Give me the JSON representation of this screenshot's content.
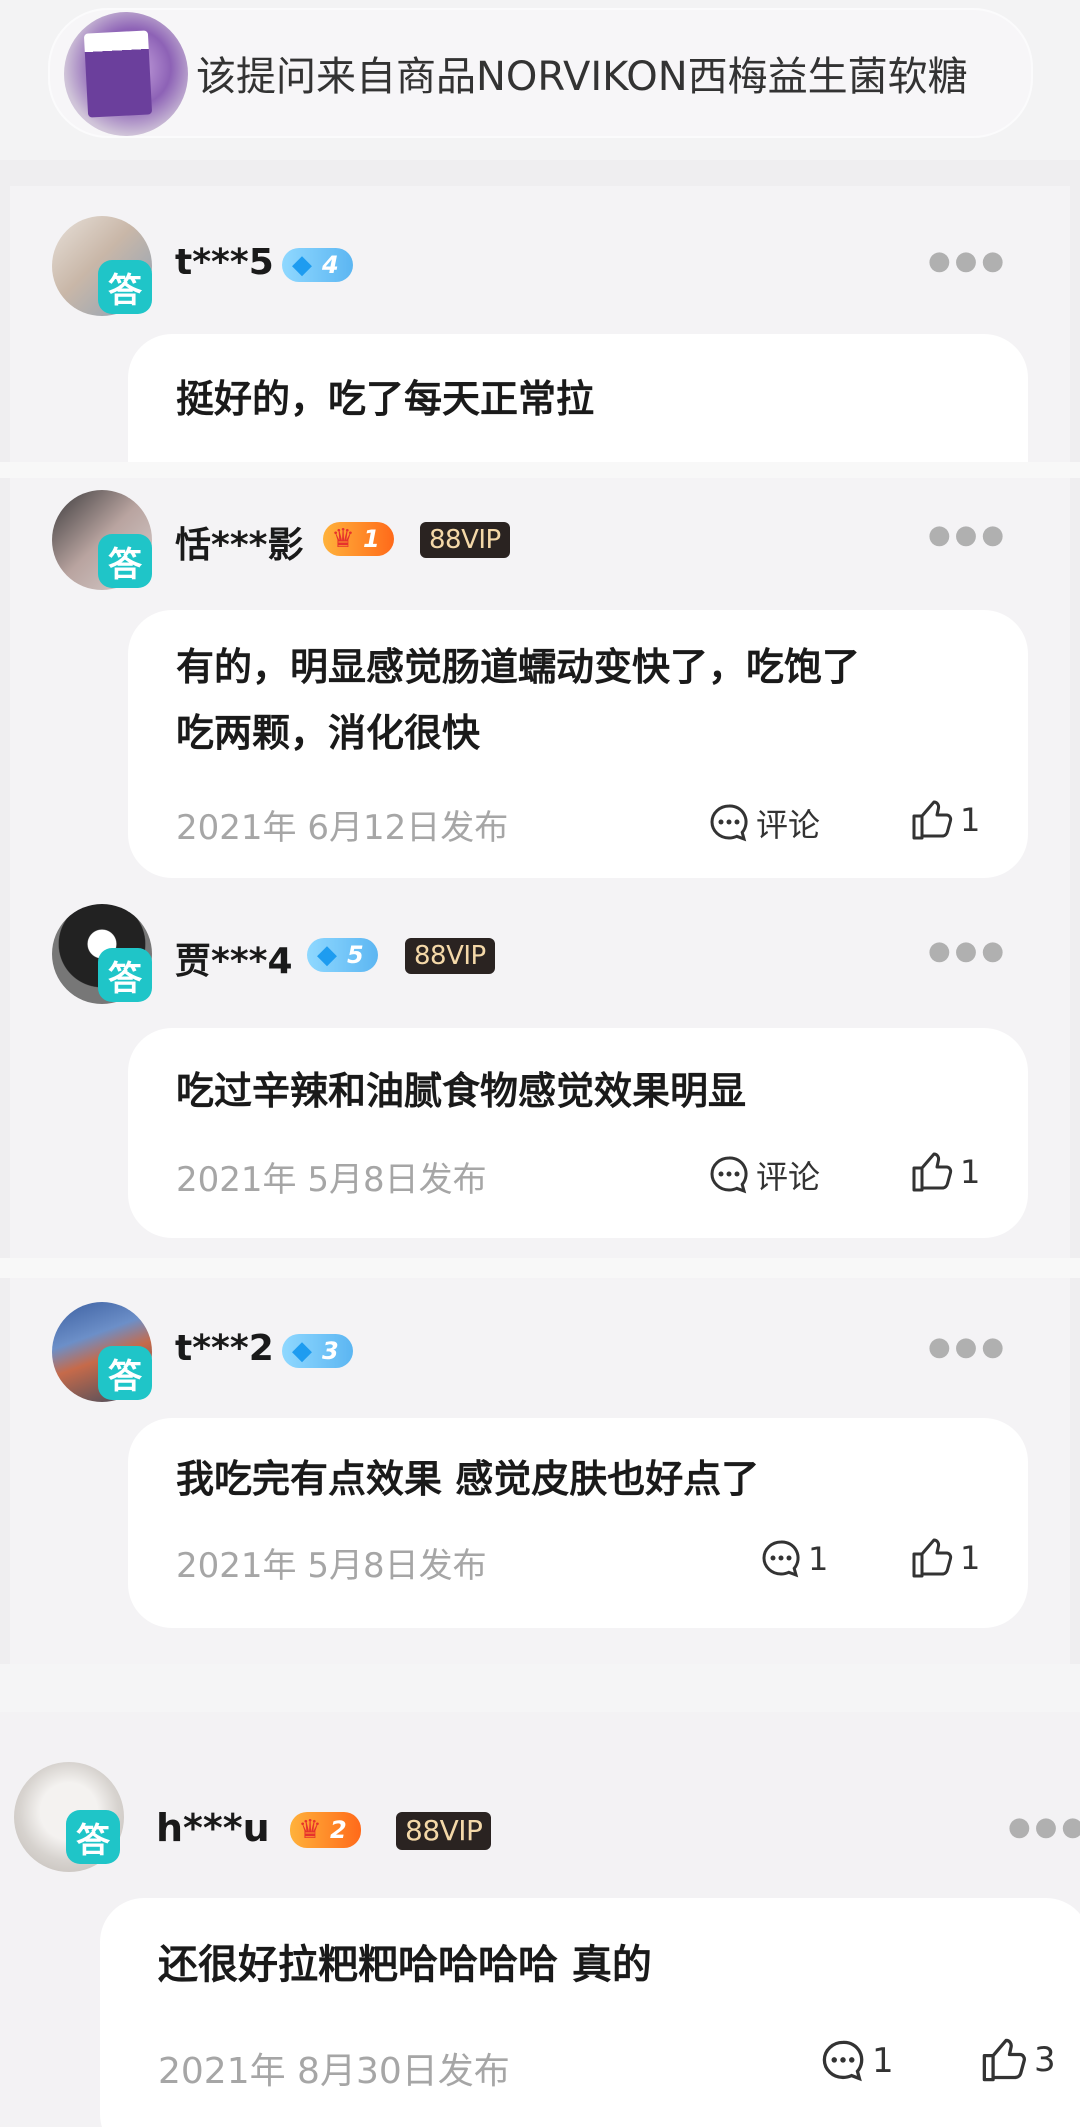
{
  "product": {
    "text": "该提问来自商品NORVIKON西梅益生菌软糖",
    "thumb": "product-thumbnail"
  },
  "answer_badge": "答",
  "icons": {
    "more": "more-dots-icon",
    "comment": "comment-bubble-icon",
    "like": "thumbs-up-icon",
    "diamond": "diamond-icon",
    "crown": "crown-icon"
  },
  "colors": {
    "answer_badge": "#1fc5c8",
    "vip_bg": "#2a2321",
    "vip_text": "#f4d8a8",
    "date": "#a6a6a6"
  },
  "answers": [
    {
      "username": "t***5",
      "level": {
        "type": "diamond",
        "value": "4"
      },
      "vip": "",
      "text": "挺好的，吃了每天正常拉"
    },
    {
      "username": "恬***影",
      "level": {
        "type": "crown",
        "value": "1"
      },
      "vip": "88VIP",
      "text_line1": "有的，明显感觉肠道蠕动变快了，吃饱了",
      "text_line2": "吃两颗，消化很快",
      "date": "2021年 6月12日发布",
      "comment_label": "评论",
      "likes": "1"
    },
    {
      "username": "贾***4",
      "level": {
        "type": "diamond",
        "value": "5"
      },
      "vip": "88VIP",
      "text": "吃过辛辣和油腻食物感觉效果明显",
      "date": "2021年 5月8日发布",
      "comment_label": "评论",
      "likes": "1"
    },
    {
      "username": "t***2",
      "level": {
        "type": "diamond",
        "value": "3"
      },
      "vip": "",
      "text": "我吃完有点效果 感觉皮肤也好点了",
      "date": "2021年 5月8日发布",
      "comments": "1",
      "likes": "1"
    },
    {
      "username": "h***u",
      "level": {
        "type": "crown",
        "value": "2"
      },
      "vip": "88VIP",
      "text": "还很好拉粑粑哈哈哈哈 真的",
      "date": "2021年 8月30日发布",
      "comments": "1",
      "likes": "3"
    }
  ]
}
